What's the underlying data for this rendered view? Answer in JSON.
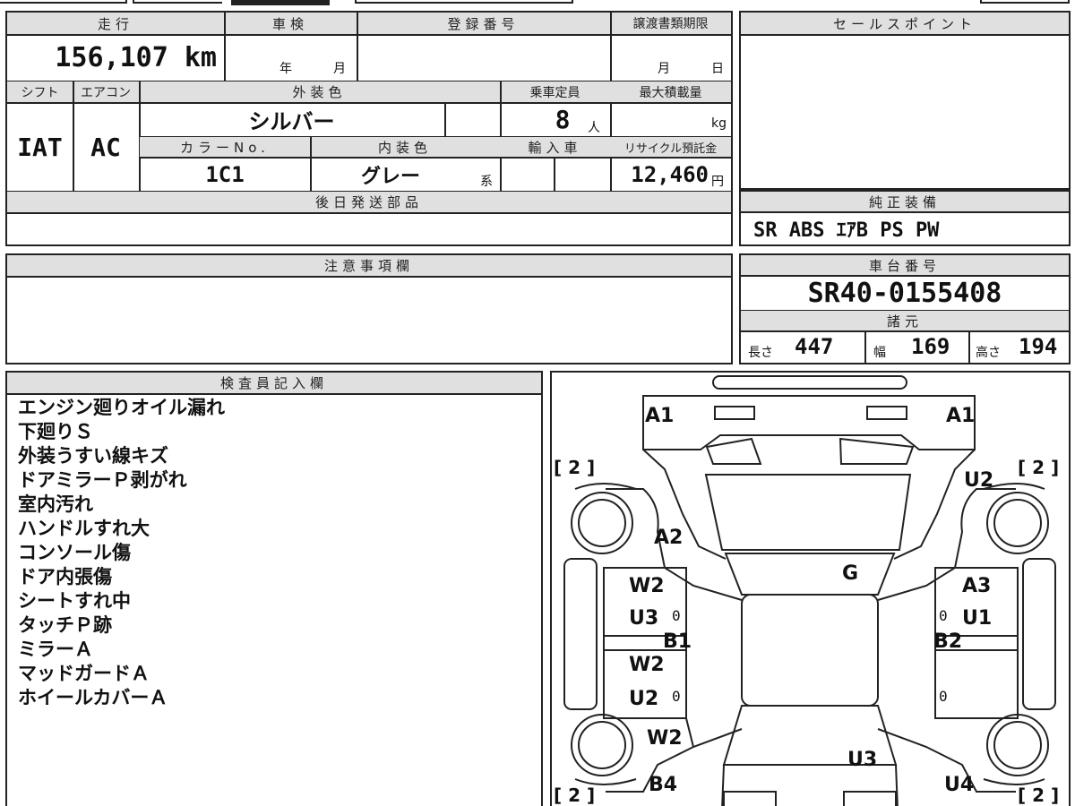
{
  "top_table": {
    "mileage_label": "走行",
    "mileage_value": "156,107 km",
    "inspection_label": "車検",
    "inspection_year": "年",
    "inspection_month": "月",
    "registration_label": "登録番号",
    "transfer_label": "譲渡書類期限",
    "transfer_month": "月",
    "transfer_day": "日",
    "shift_label": "シフト",
    "shift_value": "IAT",
    "ac_label": "エアコン",
    "ac_value": "AC",
    "exterior_label": "外装色",
    "exterior_value": "シルバー",
    "capacity_label": "乗車定員",
    "capacity_value": "8",
    "capacity_unit": "人",
    "max_load_label": "最大積載量",
    "max_load_unit": "kg",
    "color_no_label": "カラーNo.",
    "color_no_value": "1C1",
    "interior_label": "内装色",
    "interior_value": "グレー",
    "interior_suffix": "系",
    "import_label": "輸入車",
    "recycle_label": "リサイクル預託金",
    "recycle_value": "12,460",
    "recycle_unit": "円",
    "later_parts_label": "後日発送部品"
  },
  "sales_point": {
    "label": "セールスポイント"
  },
  "equipment": {
    "label": "純正装備",
    "value": "SR ABS ｴｱB PS PW"
  },
  "caution": {
    "label": "注意事項欄"
  },
  "chassis": {
    "label": "車台番号",
    "value": "SR40-0155408"
  },
  "specs": {
    "label": "諸元",
    "length_label": "長さ",
    "length_value": "447",
    "width_label": "幅",
    "width_value": "169",
    "height_label": "高さ",
    "height_value": "194"
  },
  "inspector": {
    "label": "検査員記入欄",
    "notes": [
      "エンジン廻りオイル漏れ",
      "下廻りＳ",
      "外装うすい線キズ",
      "ドアミラーＰ剥がれ",
      "室内汚れ",
      "ハンドルすれ大",
      "コンソール傷",
      "ドア内張傷",
      "シートすれ中",
      "タッチＰ跡",
      "ミラーＡ",
      "マッドガードＡ",
      "ホイールカバーＡ"
    ]
  },
  "diagram": {
    "marks": {
      "a1_left": "A1",
      "a1_right": "A1",
      "u2_right": "U2",
      "a2": "A2",
      "g": "G",
      "w2_left_1": "W2",
      "a3": "A3",
      "u3_left": "U3",
      "u1": "U1",
      "b1": "B1",
      "b2": "B2",
      "w2_left_2": "W2",
      "u2_left": "U2",
      "w2_left_3": "W2",
      "u3_bottom": "U3",
      "b4": "B4",
      "u4": "U4",
      "zero_1": "0",
      "zero_2": "0",
      "zero_3": "0",
      "zero_4": "0",
      "bracket_tl": "[ 2 ]",
      "bracket_tr": "[ 2 ]",
      "bracket_bl": "[ 2 ]",
      "bracket_br": "[ 2 ]"
    }
  }
}
